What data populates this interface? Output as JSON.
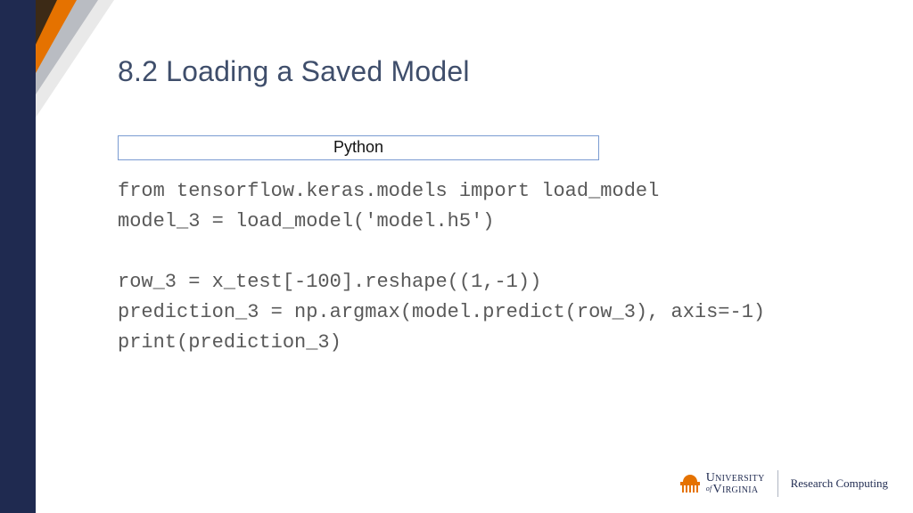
{
  "title": "8.2 Loading a Saved Model",
  "lang_label": "Python",
  "code_lines": [
    "from tensorflow.keras.models import load_model",
    "model_3 = load_model('model.h5')",
    "",
    "row_3 = x_test[-100].reshape((1,-1))",
    "prediction_3 = np.argmax(model.predict(row_3), axis=-1)",
    "print(prediction_3)"
  ],
  "footer": {
    "university_line1": "University",
    "university_of": "of",
    "university_line2": "Virginia",
    "dept": "Research Computing"
  }
}
